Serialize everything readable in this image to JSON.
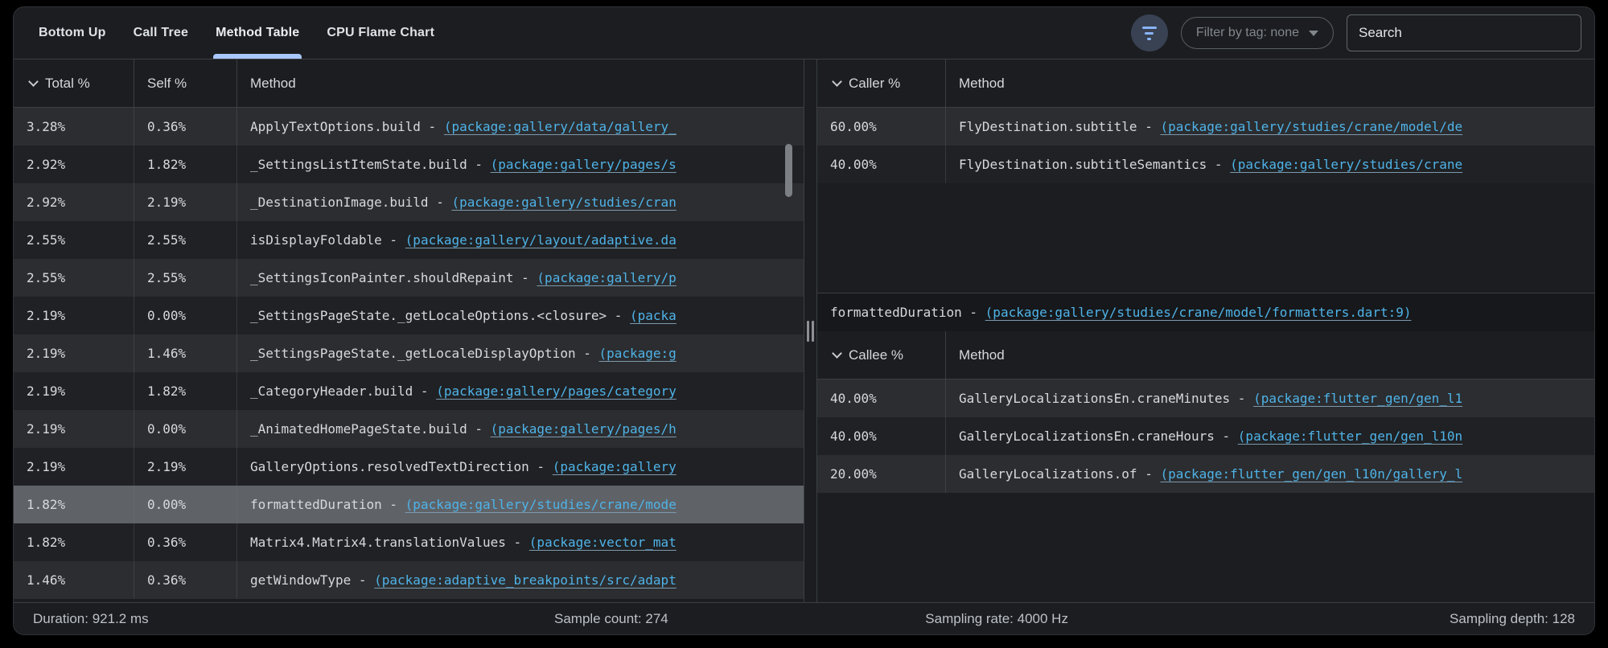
{
  "tabs": [
    {
      "label": "Bottom Up",
      "selected": false
    },
    {
      "label": "Call Tree",
      "selected": false
    },
    {
      "label": "Method Table",
      "selected": true
    },
    {
      "label": "CPU Flame Chart",
      "selected": false
    }
  ],
  "toolbar": {
    "filter_tag_label": "Filter by tag: none",
    "search_placeholder": "Search"
  },
  "separator": " - ",
  "method_table": {
    "columns": [
      "Total %",
      "Self %",
      "Method"
    ],
    "rows": [
      {
        "total": "3.28%",
        "self": "0.36%",
        "method": "ApplyTextOptions.build",
        "link": "(package:gallery/data/gallery_",
        "selected": false
      },
      {
        "total": "2.92%",
        "self": "1.82%",
        "method": "_SettingsListItemState.build",
        "link": "(package:gallery/pages/s",
        "selected": false
      },
      {
        "total": "2.92%",
        "self": "2.19%",
        "method": "_DestinationImage.build",
        "link": "(package:gallery/studies/cran",
        "selected": false
      },
      {
        "total": "2.55%",
        "self": "2.55%",
        "method": "isDisplayFoldable",
        "link": "(package:gallery/layout/adaptive.da",
        "selected": false
      },
      {
        "total": "2.55%",
        "self": "2.55%",
        "method": "_SettingsIconPainter.shouldRepaint",
        "link": "(package:gallery/p",
        "selected": false
      },
      {
        "total": "2.19%",
        "self": "0.00%",
        "method": "_SettingsPageState._getLocaleOptions.<closure>",
        "link": "(packa",
        "selected": false
      },
      {
        "total": "2.19%",
        "self": "1.46%",
        "method": "_SettingsPageState._getLocaleDisplayOption",
        "link": "(package:g",
        "selected": false
      },
      {
        "total": "2.19%",
        "self": "1.82%",
        "method": "_CategoryHeader.build",
        "link": "(package:gallery/pages/category",
        "selected": false
      },
      {
        "total": "2.19%",
        "self": "0.00%",
        "method": "_AnimatedHomePageState.build",
        "link": "(package:gallery/pages/h",
        "selected": false
      },
      {
        "total": "2.19%",
        "self": "2.19%",
        "method": "GalleryOptions.resolvedTextDirection",
        "link": "(package:gallery",
        "selected": false
      },
      {
        "total": "1.82%",
        "self": "0.00%",
        "method": "formattedDuration",
        "link": "(package:gallery/studies/crane/mode",
        "selected": true
      },
      {
        "total": "1.82%",
        "self": "0.36%",
        "method": "Matrix4.Matrix4.translationValues",
        "link": "(package:vector_mat",
        "selected": false
      },
      {
        "total": "1.46%",
        "self": "0.36%",
        "method": "getWindowType",
        "link": "(package:adaptive_breakpoints/src/adapt",
        "selected": false
      }
    ]
  },
  "callers": {
    "columns": [
      "Caller %",
      "Method"
    ],
    "rows": [
      {
        "pct": "60.00%",
        "method": "FlyDestination.subtitle",
        "link": "(package:gallery/studies/crane/model/de",
        "selected": false
      },
      {
        "pct": "40.00%",
        "method": "FlyDestination.subtitleSemantics",
        "link": "(package:gallery/studies/crane",
        "selected": false
      }
    ]
  },
  "selected_method": {
    "name": "formattedDuration",
    "link": "(package:gallery/studies/crane/model/formatters.dart:9)"
  },
  "callees": {
    "columns": [
      "Callee %",
      "Method"
    ],
    "rows": [
      {
        "pct": "40.00%",
        "method": "GalleryLocalizationsEn.craneMinutes",
        "link": "(package:flutter_gen/gen_l1",
        "selected": false
      },
      {
        "pct": "40.00%",
        "method": "GalleryLocalizationsEn.craneHours",
        "link": "(package:flutter_gen/gen_l10n",
        "selected": false
      },
      {
        "pct": "20.00%",
        "method": "GalleryLocalizations.of",
        "link": "(package:flutter_gen/gen_l10n/gallery_l",
        "selected": false
      }
    ]
  },
  "status_bar": {
    "duration": "Duration: 921.2 ms",
    "sample_count": "Sample count: 274",
    "sampling_rate": "Sampling rate: 4000 Hz",
    "sampling_depth": "Sampling depth: 128"
  },
  "icons": {
    "filter": "filter-icon",
    "dropdown_caret": "chevron-down-icon",
    "sort": "sort-chevron-icon",
    "drag_handle": "panel-drag-handle"
  },
  "colors": {
    "accent_tab_underline": "#a8c7fa",
    "link": "#4fb3e8",
    "selected_row": "#5f6368",
    "row_odd": "#2b2d30",
    "row_even": "#1f2124",
    "panel_bg": "#1b1d20",
    "border": "#3c4043"
  }
}
